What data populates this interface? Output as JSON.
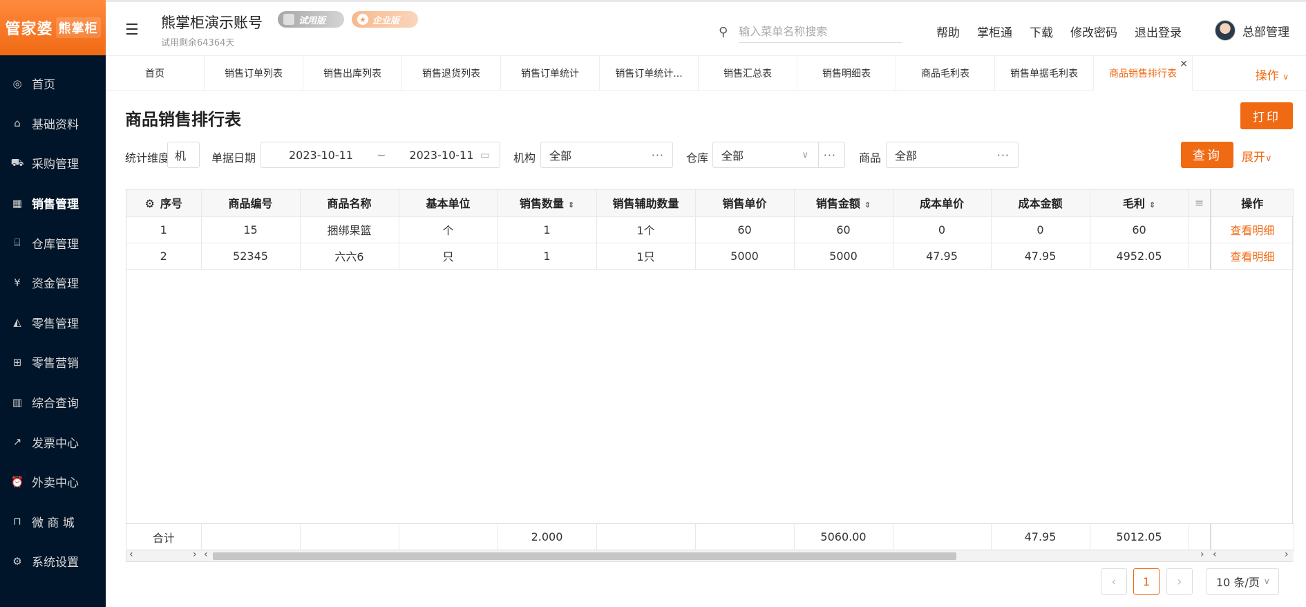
{
  "logo": {
    "main": "管家婆",
    "sub": "熊掌柜"
  },
  "sidebar": {
    "items": [
      {
        "label": "首页",
        "icon": "globe-icon",
        "active": false
      },
      {
        "label": "基础资料",
        "icon": "home-icon",
        "active": false
      },
      {
        "label": "采购管理",
        "icon": "cart-icon",
        "active": false
      },
      {
        "label": "销售管理",
        "icon": "calendar-icon",
        "active": true
      },
      {
        "label": "仓库管理",
        "icon": "bank-icon",
        "active": false
      },
      {
        "label": "资金管理",
        "icon": "money-icon",
        "active": false
      },
      {
        "label": "零售管理",
        "icon": "area-chart-icon",
        "active": false
      },
      {
        "label": "零售营销",
        "icon": "gift-icon",
        "active": false
      },
      {
        "label": "综合查询",
        "icon": "bar-chart-icon",
        "active": false
      },
      {
        "label": "发票中心",
        "icon": "line-chart-icon",
        "active": false
      },
      {
        "label": "外卖中心",
        "icon": "alarm-icon",
        "active": false
      },
      {
        "label": "微 商 城",
        "icon": "shopping-bag-icon",
        "active": false
      },
      {
        "label": "系统设置",
        "icon": "gear-icon",
        "active": false
      }
    ]
  },
  "header": {
    "account_title": "熊掌柜演示账号",
    "trial_remaining": "试用剩余64364天",
    "badge_trial": "试用版",
    "badge_enterprise": "企业版",
    "search_placeholder": "输入菜单名称搜索",
    "links": [
      "帮助",
      "掌柜通",
      "下载",
      "修改密码",
      "退出登录"
    ],
    "user_name": "总部管理"
  },
  "tabs": {
    "items": [
      "首页",
      "销售订单列表",
      "销售出库列表",
      "销售退货列表",
      "销售订单统计",
      "销售订单统计...",
      "销售汇总表",
      "销售明细表",
      "商品毛利表",
      "销售单据毛利表",
      "商品销售排行表"
    ],
    "active_index": 10,
    "op_label": "操作"
  },
  "page": {
    "title": "商品销售排行表",
    "print_label": "打印",
    "query_label": "查询",
    "expand_label": "展开"
  },
  "filters": {
    "dimension_label": "统计维度",
    "dimension_value": "机",
    "date_label": "单据日期",
    "date_from": "2023-10-11",
    "date_sep": "~",
    "date_to": "2023-10-11",
    "org_label": "机构",
    "org_value": "全部",
    "warehouse_label": "仓库",
    "warehouse_value": "全部",
    "goods_label": "商品",
    "goods_value": "全部"
  },
  "table": {
    "columns": [
      "序号",
      "商品编号",
      "商品名称",
      "基本单位",
      "销售数量",
      "销售辅助数量",
      "销售单价",
      "销售金额",
      "成本单价",
      "成本金额",
      "毛利",
      "",
      "操作"
    ],
    "rows": [
      [
        "1",
        "15",
        "捆绑果篮",
        "个",
        "1",
        "1个",
        "60",
        "60",
        "0",
        "0",
        "60",
        "",
        "查看明细"
      ],
      [
        "2",
        "52345",
        "六六6",
        "只",
        "1",
        "1只",
        "5000",
        "5000",
        "47.95",
        "47.95",
        "4952.05",
        "",
        "查看明细"
      ]
    ],
    "footer": [
      "合计",
      "",
      "",
      "",
      "2.000",
      "",
      "",
      "5060.00",
      "",
      "47.95",
      "5012.05",
      "",
      ""
    ]
  },
  "pagination": {
    "current": "1",
    "page_size": "10 条/页"
  }
}
